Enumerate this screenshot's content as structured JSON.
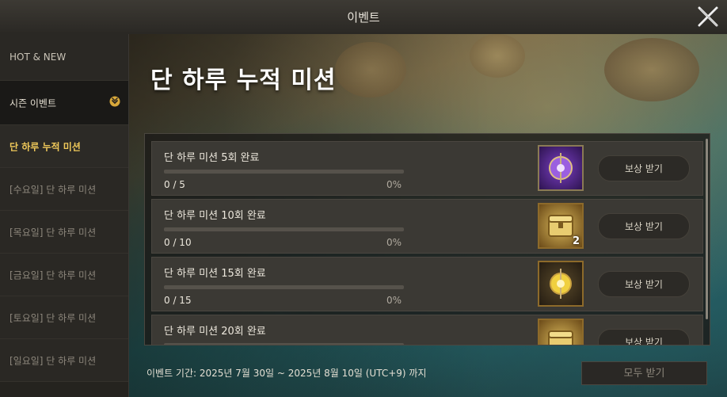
{
  "window": {
    "title": "이벤트"
  },
  "sidebar": {
    "items": [
      {
        "label": "HOT & NEW"
      },
      {
        "label": "시즌 이벤트"
      },
      {
        "label": "단 하루 누적 미션"
      },
      {
        "label": "[수요일] 단 하루 미션"
      },
      {
        "label": "[목요일] 단 하루 미션"
      },
      {
        "label": "[금요일] 단 하루 미션"
      },
      {
        "label": "[토요일] 단 하루 미션"
      },
      {
        "label": "[일요일] 단 하루 미션"
      }
    ]
  },
  "main": {
    "headline": "단 하루 누적 미션",
    "missions": [
      {
        "title": "단 하루 미션 5회 완료",
        "count": "0 / 5",
        "percent": "0%",
        "progress": 0,
        "reward_icon": "purple-orb-scroll-icon",
        "reward_qty": "",
        "button": "보상 받기"
      },
      {
        "title": "단 하루 미션 10회 완료",
        "count": "0 / 10",
        "percent": "0%",
        "progress": 0,
        "reward_icon": "gold-chest-icon",
        "reward_qty": "2",
        "button": "보상 받기"
      },
      {
        "title": "단 하루 미션 15회 완료",
        "count": "0 / 15",
        "percent": "0%",
        "progress": 0,
        "reward_icon": "gold-orb-scroll-icon",
        "reward_qty": "",
        "button": "보상 받기"
      },
      {
        "title": "단 하루 미션 20회 완료",
        "count": "",
        "percent": "",
        "progress": 0,
        "reward_icon": "gold-chest-icon",
        "reward_qty": "",
        "button": "보상 받기"
      }
    ],
    "period": "이벤트 기간: 2025년 7월 30일 ~ 2025년 8월 10일 (UTC+9) 까지",
    "claim_all": "모두 받기"
  },
  "colors": {
    "active_tab": "#f0c95a",
    "panel": "#3b3934"
  }
}
